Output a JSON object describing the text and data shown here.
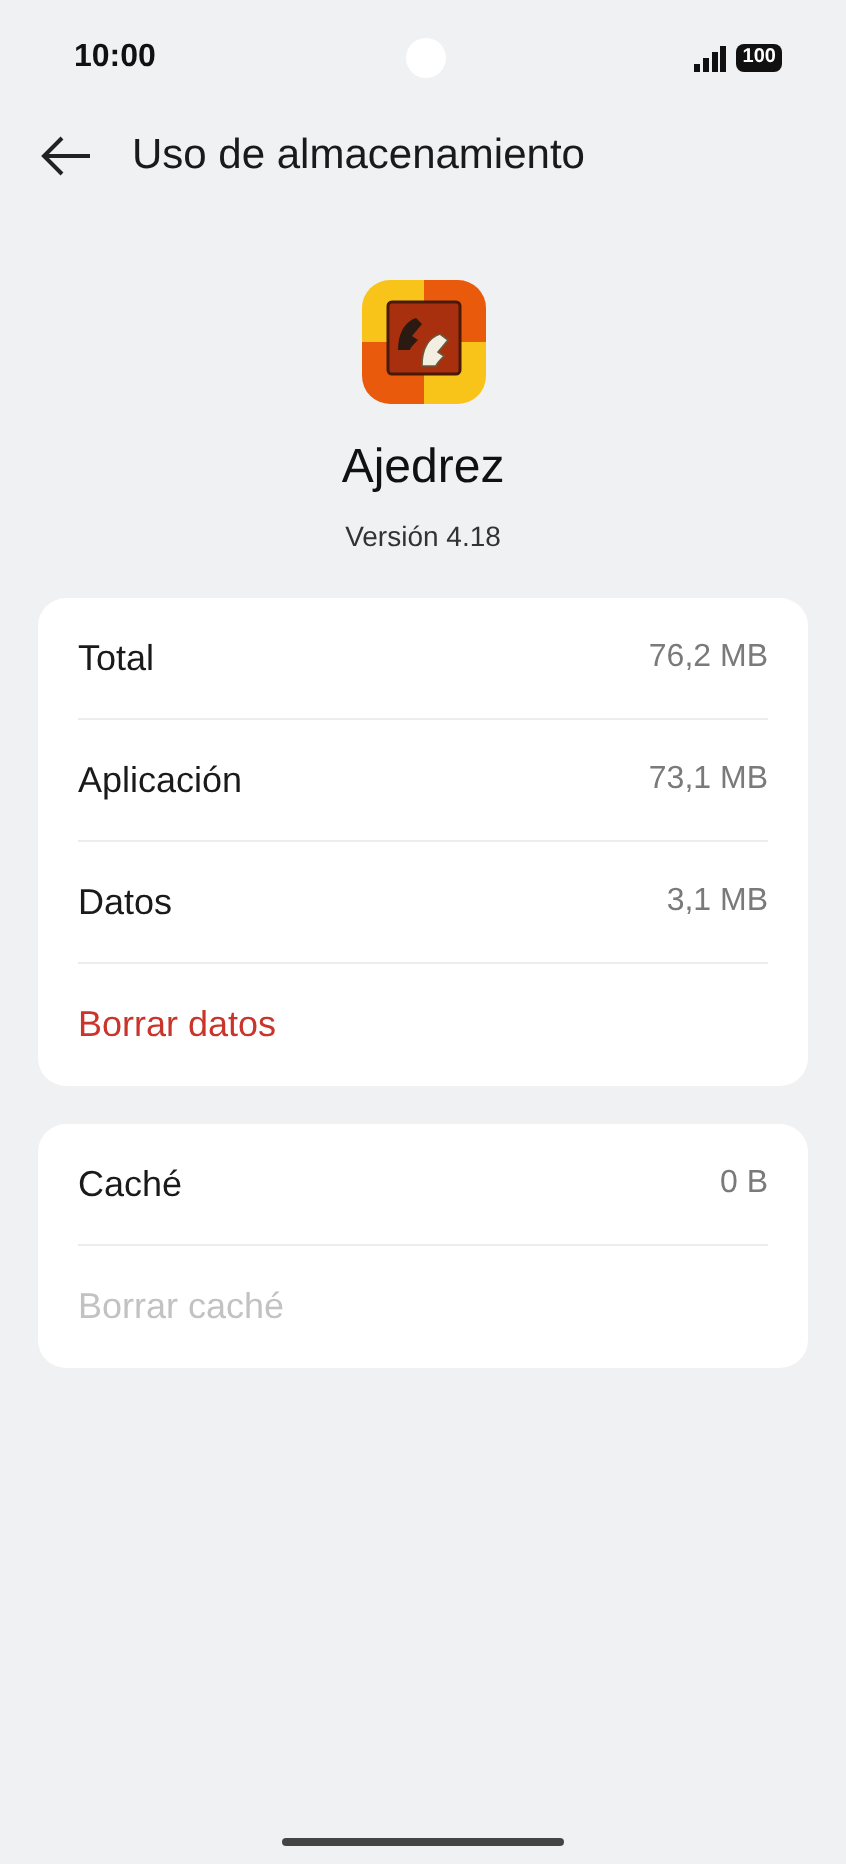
{
  "status_bar": {
    "time": "10:00",
    "battery": "100"
  },
  "header": {
    "title": "Uso de almacenamiento"
  },
  "app": {
    "name": "Ajedrez",
    "version": "Versión 4.18"
  },
  "cards": [
    {
      "rows": [
        {
          "kind": "value",
          "label": "Total",
          "value": "76,2 MB"
        },
        {
          "kind": "value",
          "label": "Aplicación",
          "value": "73,1 MB"
        },
        {
          "kind": "value",
          "label": "Datos",
          "value": "3,1 MB"
        },
        {
          "kind": "action",
          "label": "Borrar datos",
          "disabled": false
        }
      ]
    },
    {
      "rows": [
        {
          "kind": "value",
          "label": "Caché",
          "value": "0 B"
        },
        {
          "kind": "action",
          "label": "Borrar caché",
          "disabled": true
        }
      ]
    }
  ]
}
